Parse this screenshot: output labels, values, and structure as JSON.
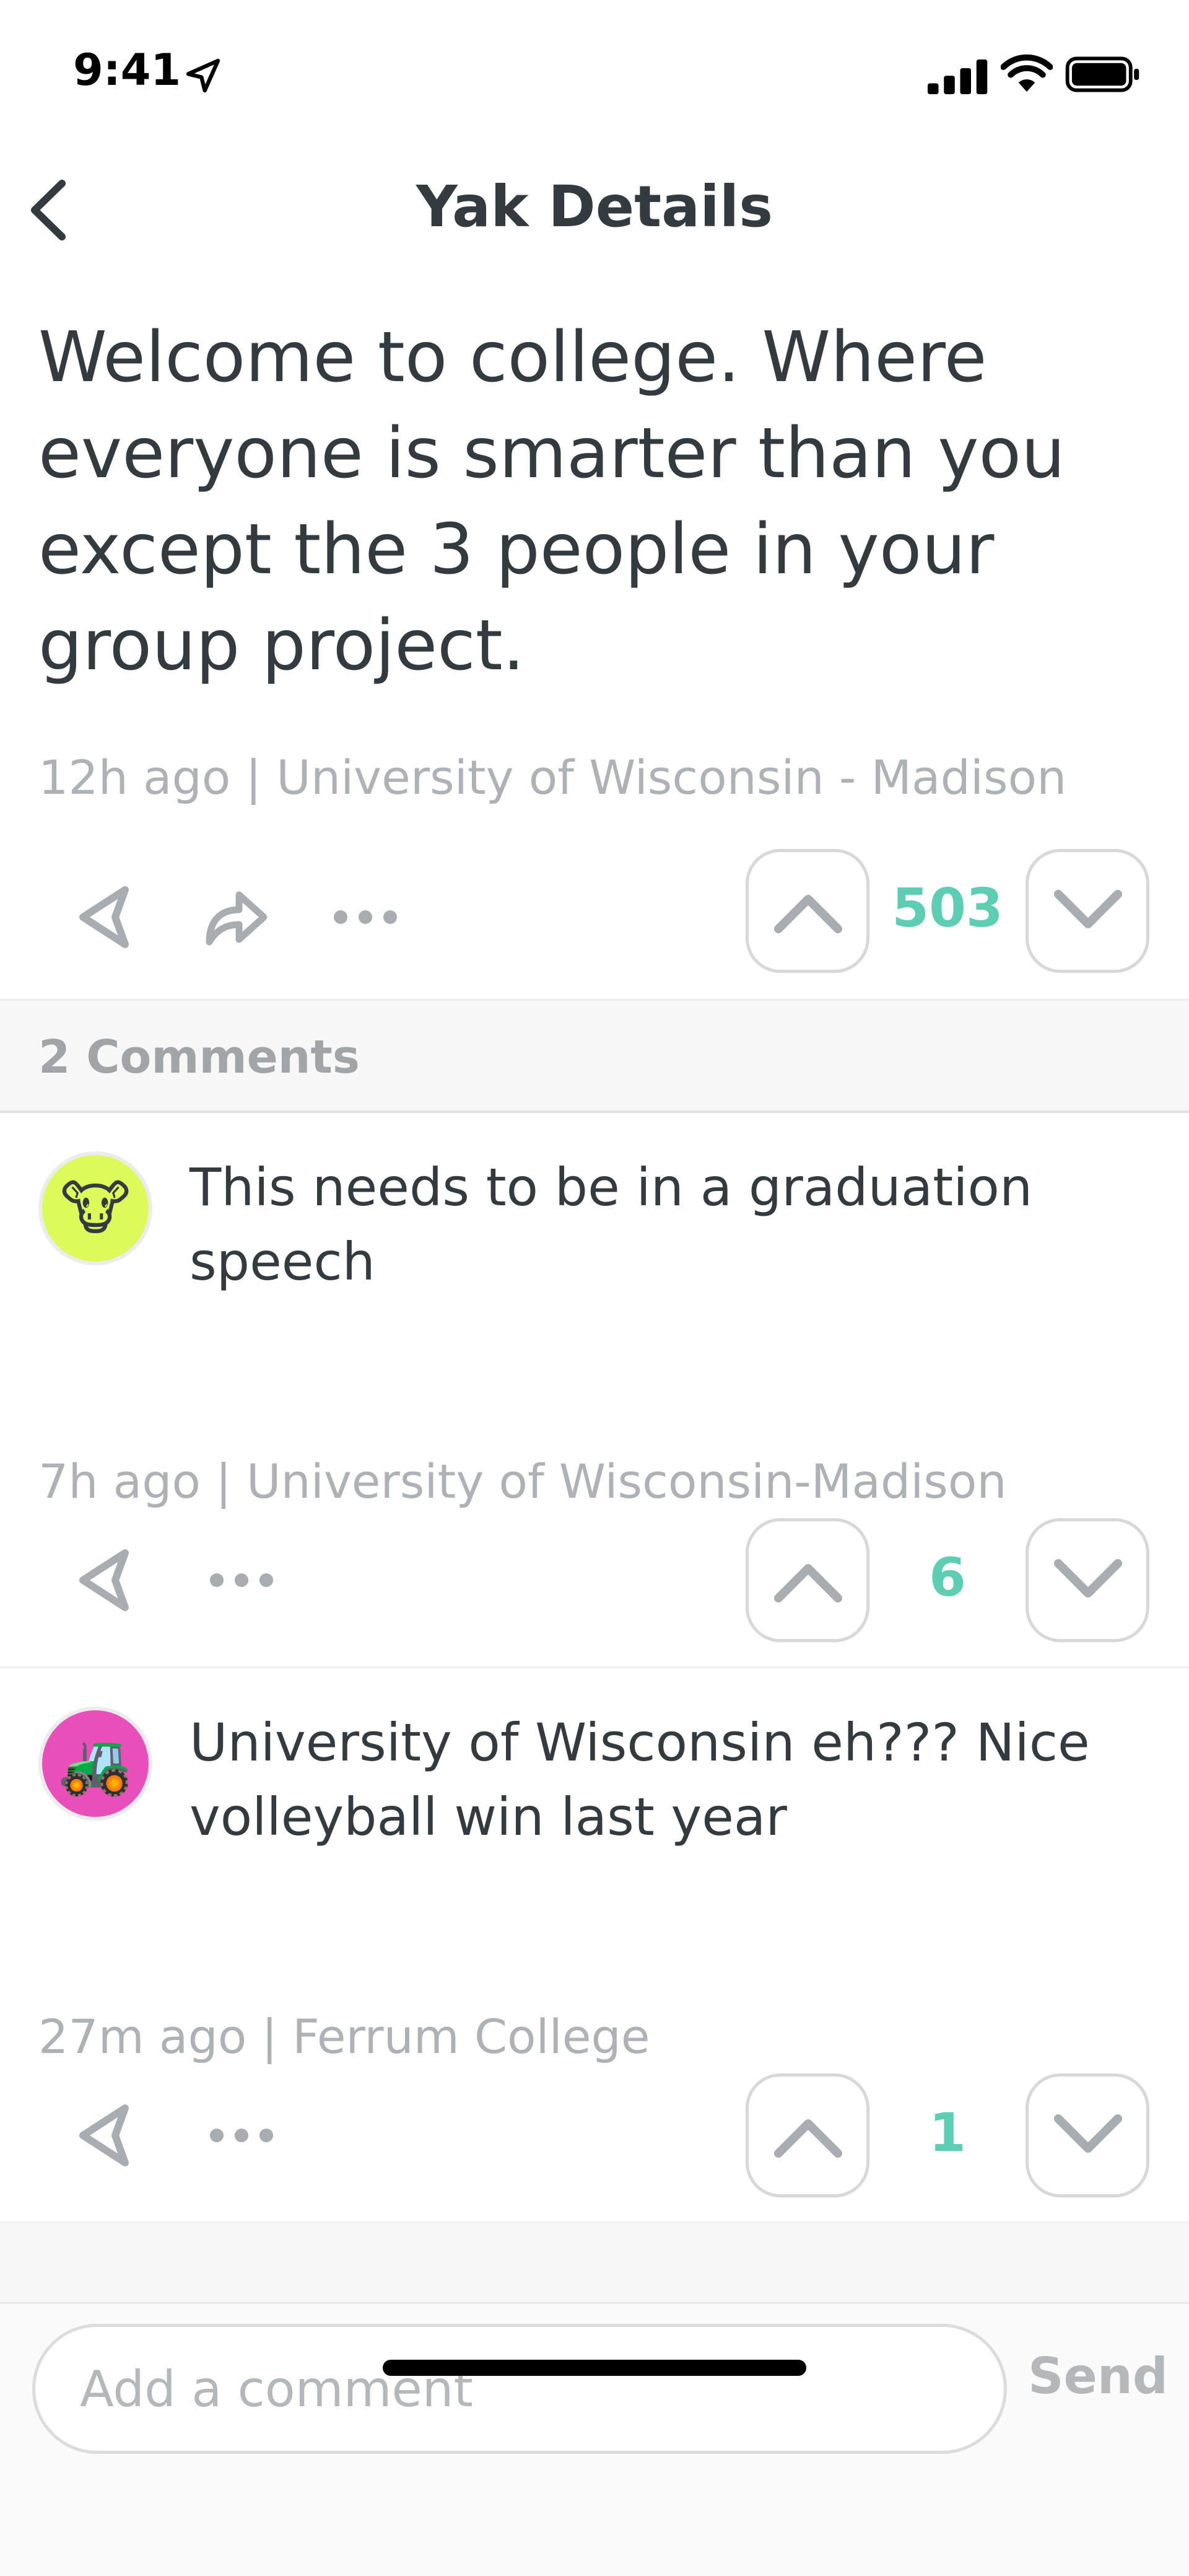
{
  "status_bar": {
    "time": "9:41"
  },
  "nav": {
    "title": "Yak Details"
  },
  "post": {
    "text": "Welcome to college. Where everyone is smarter than you except the 3 people in your group project.",
    "meta": "12h ago | University of Wisconsin - Madison",
    "votes": "503"
  },
  "comments_header": {
    "count_label": "2 Comments"
  },
  "comments": [
    {
      "avatar": "🐮",
      "avatar_color": "#dcfa5a",
      "text": "This needs to be in a graduation speech",
      "meta": "7h ago | University of Wisconsin-Madison",
      "votes": "6"
    },
    {
      "avatar": "🚜",
      "avatar_color": "#e84fb8",
      "text": "University of Wisconsin eh??? Nice volleyball win last year",
      "meta": "27m ago | Ferrum College",
      "votes": "1"
    }
  ],
  "input": {
    "placeholder": "Add a comment",
    "send_label": "Send"
  },
  "colors": {
    "accent": "#5dcdb4",
    "muted": "#aeb2b6",
    "text": "#333a40"
  }
}
